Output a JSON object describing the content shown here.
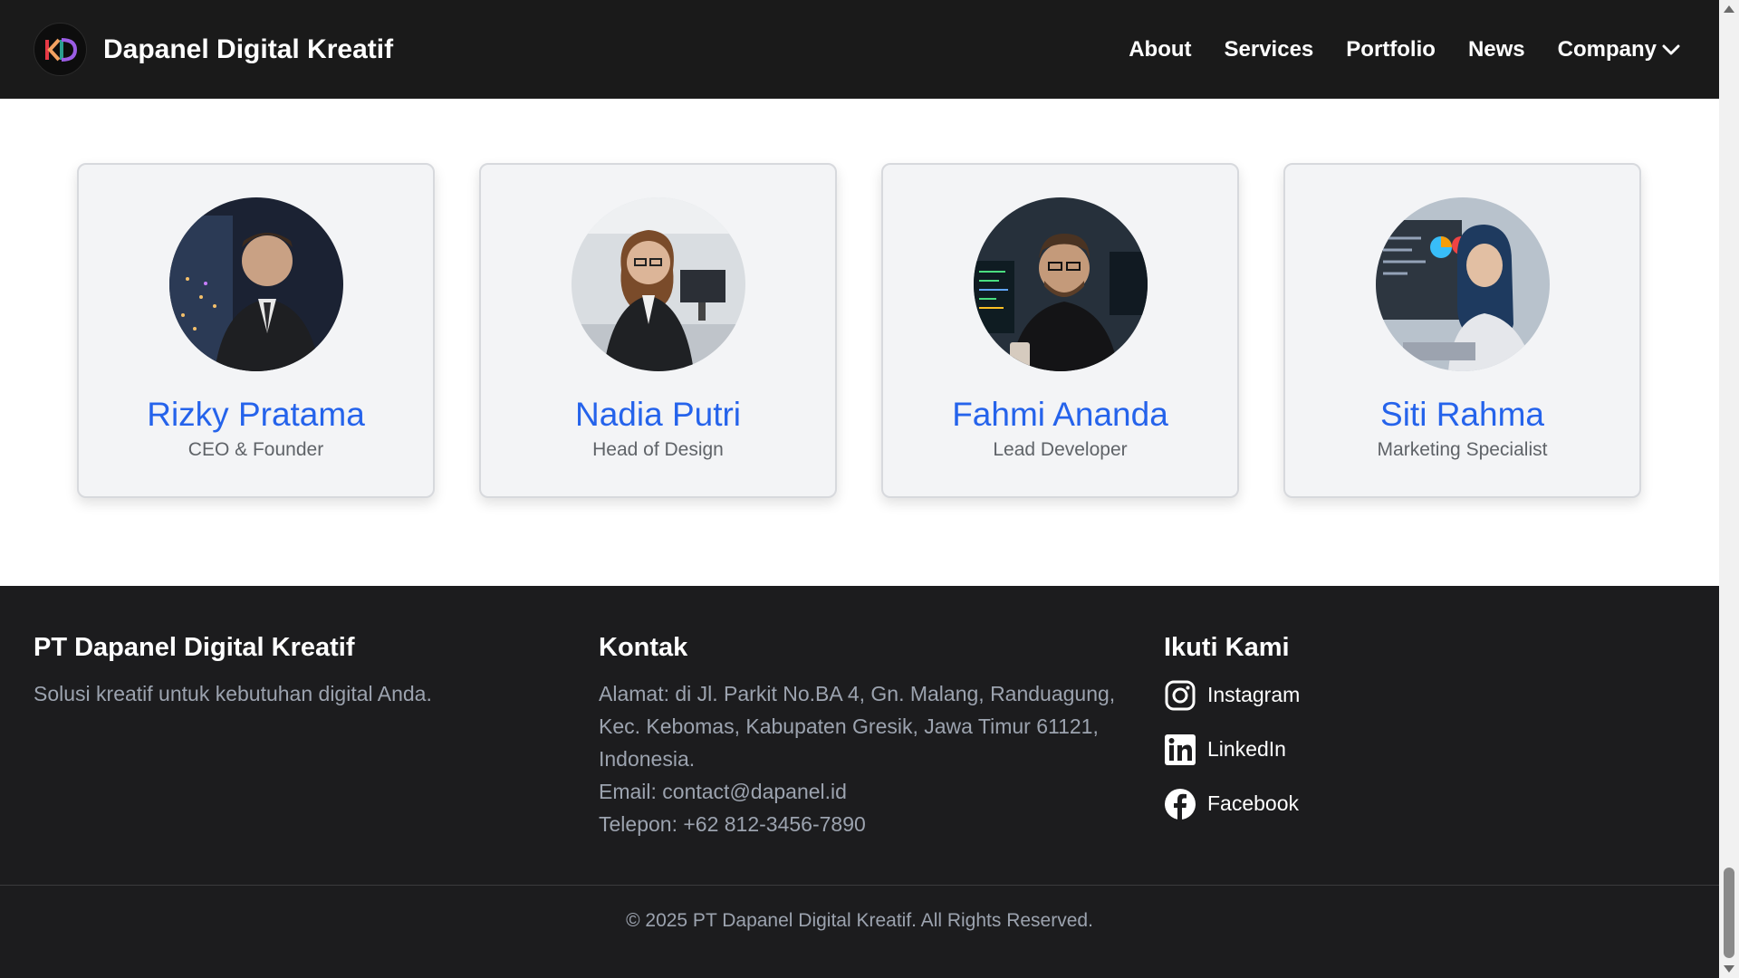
{
  "header": {
    "brand": "Dapanel Digital Kreatif",
    "logo_text": "KD",
    "nav": [
      {
        "label": "About"
      },
      {
        "label": "Services"
      },
      {
        "label": "Portfolio"
      },
      {
        "label": "News"
      },
      {
        "label": "Company",
        "icon": "chevron-down-icon"
      }
    ]
  },
  "team": [
    {
      "name": "Rizky Pratama",
      "role": "CEO & Founder"
    },
    {
      "name": "Nadia Putri",
      "role": "Head of Design"
    },
    {
      "name": "Fahmi Ananda",
      "role": "Lead Developer"
    },
    {
      "name": "Siti Rahma",
      "role": "Marketing Specialist"
    }
  ],
  "footer": {
    "company": {
      "title": "PT Dapanel Digital Kreatif",
      "tagline": "Solusi kreatif untuk kebutuhan digital Anda."
    },
    "contact": {
      "title": "Kontak",
      "address": "Alamat: di Jl. Parkit No.BA 4, Gn. Malang, Randuagung, Kec. Kebomas, Kabupaten Gresik, Jawa Timur 61121, Indonesia.",
      "email": "Email: contact@dapanel.id",
      "phone": "Telepon: +62 812-3456-7890"
    },
    "follow": {
      "title": "Ikuti Kami",
      "links": [
        {
          "label": "Instagram",
          "icon": "instagram-icon"
        },
        {
          "label": "LinkedIn",
          "icon": "linkedin-icon"
        },
        {
          "label": "Facebook",
          "icon": "facebook-icon"
        }
      ]
    },
    "copyright": "© 2025 PT Dapanel Digital Kreatif. All Rights Reserved."
  },
  "colors": {
    "header_bg": "#1a1a1a",
    "footer_bg": "#1c1c1e",
    "accent": "#2563eb",
    "card_bg": "#f3f4f6"
  }
}
